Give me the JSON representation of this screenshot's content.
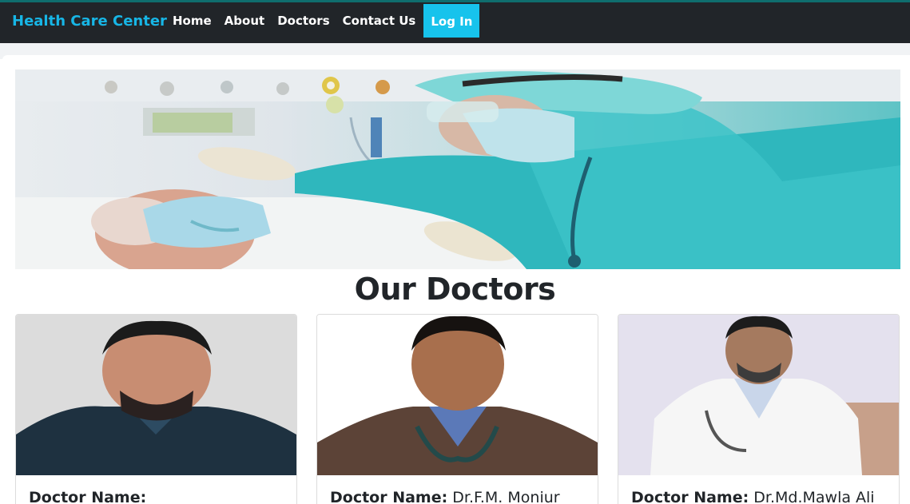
{
  "navbar": {
    "brand": "Health Care Center",
    "links": [
      "Home",
      "About",
      "Doctors",
      "Contact Us"
    ],
    "login": "Log In",
    "colors": {
      "background": "#212529",
      "accent": "#17c3ec"
    }
  },
  "hero": {
    "image": "icu-doctor-with-patient"
  },
  "main": {
    "title": "Our Doctors",
    "doctors": [
      {
        "label": "Doctor Name:",
        "name": ""
      },
      {
        "label": "Doctor Name:",
        "name": "Dr.F.M. Moniur"
      },
      {
        "label": "Doctor Name:",
        "name": "Dr.Md.Mawla Ali"
      }
    ]
  }
}
